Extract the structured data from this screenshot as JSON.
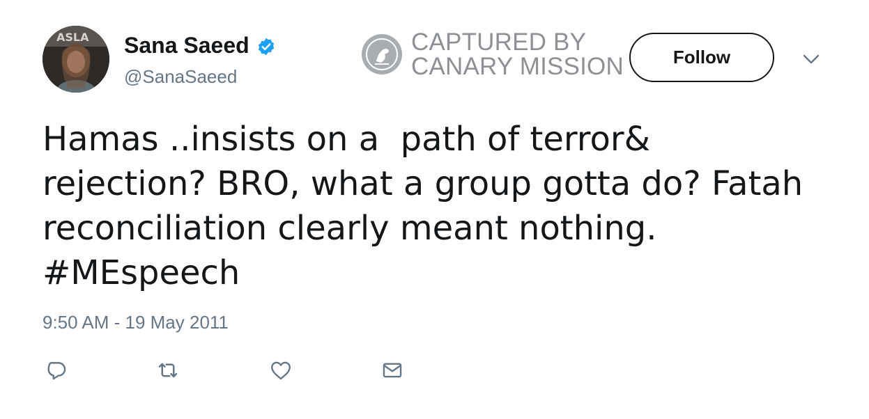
{
  "user": {
    "display_name": "Sana Saeed",
    "handle": "@SanaSaeed",
    "verified": true
  },
  "watermark": {
    "line1": "CAPTURED BY",
    "line2": "CANARY MISSION"
  },
  "follow_button": {
    "label": "Follow"
  },
  "tweet": {
    "text": "Hamas ..insists on a  path of terror&\nrejection? BRO, what a group gotta do? Fatah\nreconciliation clearly meant nothing.\n#MEspeech",
    "timestamp": "9:50 AM - 19 May 2011"
  },
  "actions": [
    "reply-icon",
    "retweet-icon",
    "like-icon",
    "direct-message-icon"
  ],
  "colors": {
    "text": "#14171a",
    "secondary": "#657786",
    "verified": "#1da1f2",
    "watermark": "#8d9196"
  }
}
